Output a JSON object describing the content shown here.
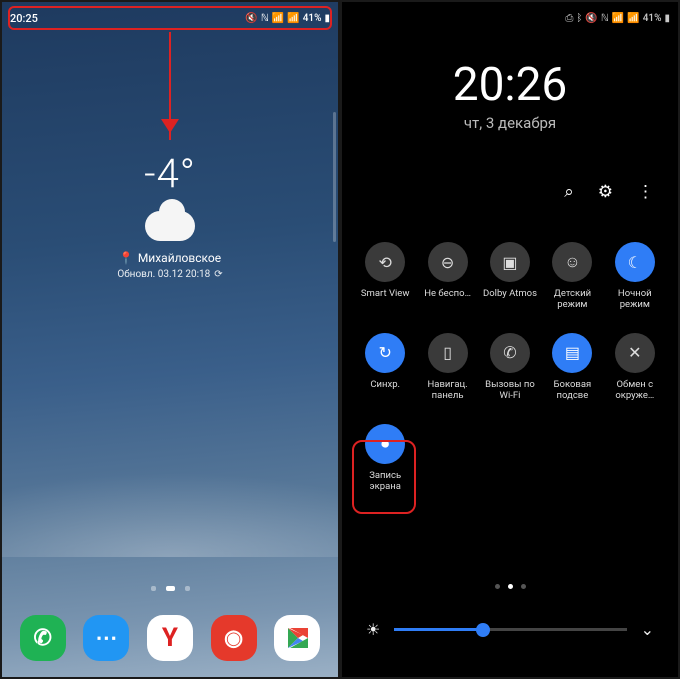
{
  "left": {
    "status": {
      "time": "20:25",
      "battery": "41%",
      "right_icons": "📶 📶 41% 🔋"
    },
    "weather": {
      "temp": "-4°",
      "location": "Михайловское",
      "updated": "Обновл. 03.12 20:18"
    },
    "dock": {
      "phone": "C",
      "messages": "💬",
      "yandex": "Y",
      "camera": "◉",
      "play": "▶"
    }
  },
  "right": {
    "status": {
      "battery": "41%"
    },
    "clock": {
      "time": "20:26",
      "date": "чт, 3 декабря"
    },
    "tools": {
      "search": "⌕",
      "settings": "⚙",
      "more": "⋮"
    },
    "tiles": [
      {
        "id": "smart-view",
        "label": "Smart View",
        "icon": "⟲",
        "on": false
      },
      {
        "id": "dnd",
        "label": "Не беспо…",
        "icon": "⊖",
        "on": false
      },
      {
        "id": "dolby",
        "label": "Dolby Atmos",
        "icon": "▣",
        "on": false
      },
      {
        "id": "kids",
        "label": "Детский режим",
        "icon": "☺",
        "on": false
      },
      {
        "id": "night",
        "label": "Ночной режим",
        "icon": "☾",
        "on": true
      },
      {
        "id": "sync",
        "label": "Синхр.",
        "icon": "↻",
        "on": true
      },
      {
        "id": "nav",
        "label": "Навигац. панель",
        "icon": "▯",
        "on": false
      },
      {
        "id": "wifi-call",
        "label": "Вызовы по Wi-Fi",
        "icon": "✆",
        "on": false
      },
      {
        "id": "edge",
        "label": "Боковая подсве",
        "icon": "▤",
        "on": true
      },
      {
        "id": "share",
        "label": "Обмен с окруже…",
        "icon": "✕",
        "on": false
      },
      {
        "id": "record",
        "label": "Запись экрана",
        "icon": "⏺",
        "on": true
      }
    ],
    "brightness": {
      "value": 38,
      "expand": "⌄",
      "icon": "☀"
    }
  }
}
